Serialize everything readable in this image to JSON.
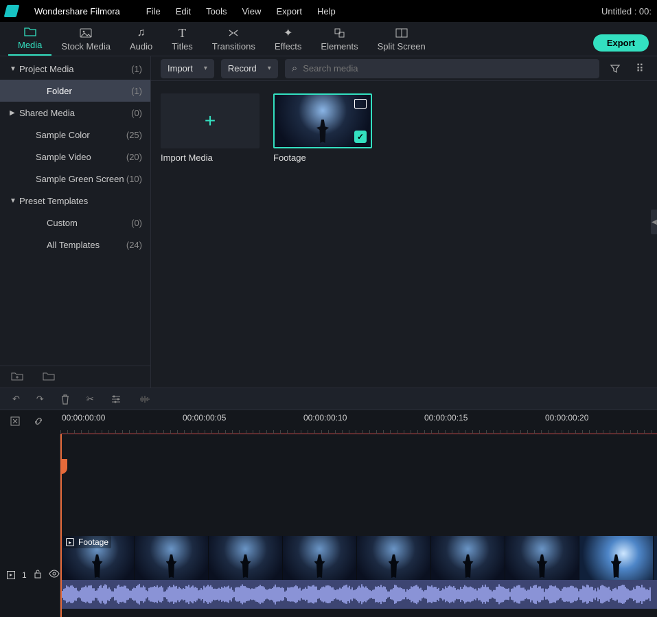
{
  "app": {
    "name": "Wondershare Filmora",
    "project_status": "Untitled : 00:"
  },
  "menus": [
    "File",
    "Edit",
    "Tools",
    "View",
    "Export",
    "Help"
  ],
  "tabs": [
    {
      "id": "media",
      "label": "Media",
      "icon": "folder-icon",
      "active": true
    },
    {
      "id": "stock",
      "label": "Stock Media",
      "icon": "image-icon",
      "active": false
    },
    {
      "id": "audio",
      "label": "Audio",
      "icon": "music-icon",
      "active": false
    },
    {
      "id": "titles",
      "label": "Titles",
      "icon": "text-icon",
      "active": false
    },
    {
      "id": "transitions",
      "label": "Transitions",
      "icon": "transition-icon",
      "active": false
    },
    {
      "id": "effects",
      "label": "Effects",
      "icon": "sparkle-icon",
      "active": false
    },
    {
      "id": "elements",
      "label": "Elements",
      "icon": "shapes-icon",
      "active": false
    },
    {
      "id": "split",
      "label": "Split Screen",
      "icon": "split-icon",
      "active": false
    }
  ],
  "export_label": "Export",
  "sidebar": {
    "items": [
      {
        "label": "Project Media",
        "count": "(1)",
        "level": "root",
        "expanded": true
      },
      {
        "label": "Folder",
        "count": "(1)",
        "level": "gchild",
        "active": true
      },
      {
        "label": "Shared Media",
        "count": "(0)",
        "level": "root",
        "collapsed": true
      },
      {
        "label": "Sample Color",
        "count": "(25)",
        "level": "child"
      },
      {
        "label": "Sample Video",
        "count": "(20)",
        "level": "child"
      },
      {
        "label": "Sample Green Screen",
        "count": "(10)",
        "level": "child"
      },
      {
        "label": "Preset Templates",
        "count": "",
        "level": "root",
        "expanded": true
      },
      {
        "label": "Custom",
        "count": "(0)",
        "level": "gchild"
      },
      {
        "label": "All Templates",
        "count": "(24)",
        "level": "gchild"
      }
    ]
  },
  "content_controls": {
    "import_label": "Import",
    "record_label": "Record",
    "search_placeholder": "Search media"
  },
  "gallery": {
    "import_label": "Import Media",
    "clip_label": "Footage"
  },
  "timeline": {
    "ticks": [
      "00:00:00:00",
      "00:00:00:05",
      "00:00:00:10",
      "00:00:00:15",
      "00:00:00:20"
    ],
    "clip_label": "Footage",
    "track_badge": "1"
  },
  "icons": {
    "folder": "▭",
    "image": "▣",
    "music": "♫",
    "text": "T",
    "transition": "⇄",
    "sparkle": "✦",
    "shapes": "◧",
    "split": "▥",
    "search": "⌕",
    "filter": "⩚",
    "grid": "⠿",
    "newfolder": "⊞",
    "openfolder": "▭",
    "undo": "↶",
    "redo": "↷",
    "trash": "🗑",
    "cut": "✂",
    "sliders": "≡",
    "waveform": "≋",
    "marker": "◳",
    "link": "∞",
    "play": "▸",
    "lock": "🔓",
    "eye": "👁",
    "check": "✓"
  }
}
